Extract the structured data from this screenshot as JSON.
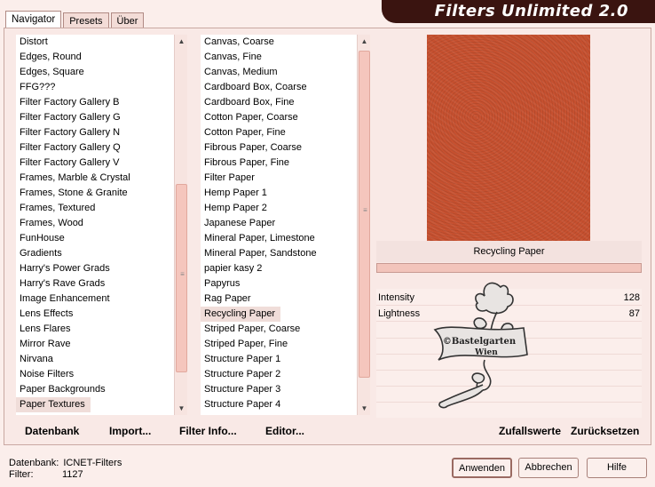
{
  "window": {
    "title": "Filters Unlimited 2.0"
  },
  "tabs": [
    {
      "label": "Navigator",
      "active": true
    },
    {
      "label": "Presets",
      "active": false
    },
    {
      "label": "Über",
      "active": false
    }
  ],
  "categories": {
    "selected": "Paper Textures",
    "items": [
      "Distort",
      "Edges, Round",
      "Edges, Square",
      "FFG???",
      "Filter Factory Gallery B",
      "Filter Factory Gallery G",
      "Filter Factory Gallery N",
      "Filter Factory Gallery Q",
      "Filter Factory Gallery V",
      "Frames, Marble & Crystal",
      "Frames, Stone & Granite",
      "Frames, Textured",
      "Frames, Wood",
      "FunHouse",
      "Gradients",
      "Harry's Power Grads",
      "Harry's Rave Grads",
      "Image Enhancement",
      "Lens Effects",
      "Lens Flares",
      "Mirror Rave",
      "Nirvana",
      "Noise Filters",
      "Paper Backgrounds",
      "Paper Textures"
    ]
  },
  "filters": {
    "selected": "Recycling Paper",
    "items": [
      "Canvas, Coarse",
      "Canvas, Fine",
      "Canvas, Medium",
      "Cardboard Box, Coarse",
      "Cardboard Box, Fine",
      "Cotton Paper, Coarse",
      "Cotton Paper, Fine",
      "Fibrous Paper, Coarse",
      "Fibrous Paper, Fine",
      "Filter Paper",
      "Hemp Paper 1",
      "Hemp Paper 2",
      "Japanese Paper",
      "Mineral Paper, Limestone",
      "Mineral Paper, Sandstone",
      "papier kasy 2",
      "Papyrus",
      "Rag Paper",
      "Recycling Paper",
      "Striped Paper, Coarse",
      "Striped Paper, Fine",
      "Structure Paper 1",
      "Structure Paper 2",
      "Structure Paper 3",
      "Structure Paper 4"
    ]
  },
  "preview": {
    "filter_name": "Recycling Paper",
    "color": "#c6502f"
  },
  "params": [
    {
      "label": "Intensity",
      "value": "128"
    },
    {
      "label": "Lightness",
      "value": "87"
    }
  ],
  "watermark": {
    "line1": "©Bastelgarten",
    "line2": "Wien"
  },
  "left_links": {
    "database": "Datenbank",
    "import": "Import...",
    "filter_info": "Filter Info...",
    "editor": "Editor..."
  },
  "right_links": {
    "random": "Zufallswerte",
    "reset": "Zurücksetzen"
  },
  "status": {
    "db_label": "Datenbank:",
    "db_value": "ICNET-Filters",
    "filter_label": "Filter:",
    "filter_value": "1127"
  },
  "buttons": {
    "apply": "Anwenden",
    "cancel": "Abbrechen",
    "help": "Hilfe"
  }
}
